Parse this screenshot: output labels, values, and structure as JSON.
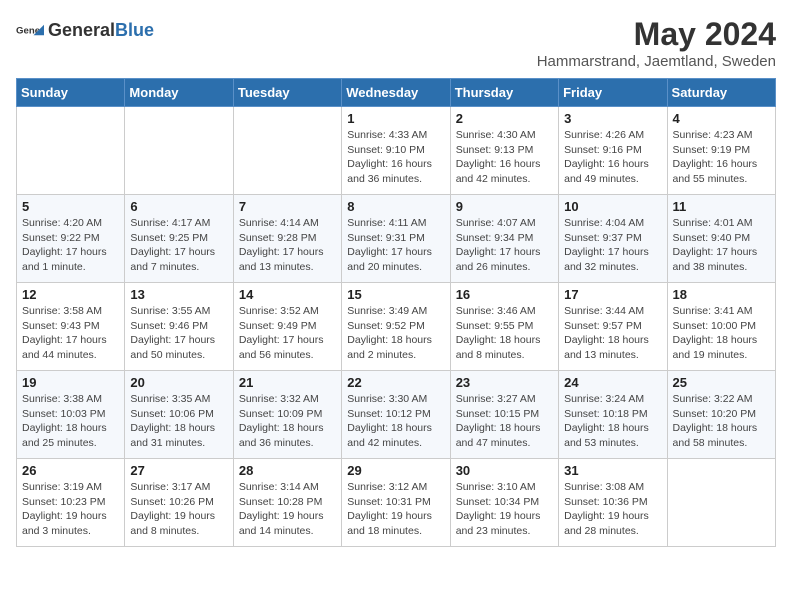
{
  "header": {
    "logo_general": "General",
    "logo_blue": "Blue",
    "month_title": "May 2024",
    "subtitle": "Hammarstrand, Jaemtland, Sweden"
  },
  "days_of_week": [
    "Sunday",
    "Monday",
    "Tuesday",
    "Wednesday",
    "Thursday",
    "Friday",
    "Saturday"
  ],
  "weeks": [
    [
      {
        "day": "",
        "info": ""
      },
      {
        "day": "",
        "info": ""
      },
      {
        "day": "",
        "info": ""
      },
      {
        "day": "1",
        "info": "Sunrise: 4:33 AM\nSunset: 9:10 PM\nDaylight: 16 hours and 36 minutes."
      },
      {
        "day": "2",
        "info": "Sunrise: 4:30 AM\nSunset: 9:13 PM\nDaylight: 16 hours and 42 minutes."
      },
      {
        "day": "3",
        "info": "Sunrise: 4:26 AM\nSunset: 9:16 PM\nDaylight: 16 hours and 49 minutes."
      },
      {
        "day": "4",
        "info": "Sunrise: 4:23 AM\nSunset: 9:19 PM\nDaylight: 16 hours and 55 minutes."
      }
    ],
    [
      {
        "day": "5",
        "info": "Sunrise: 4:20 AM\nSunset: 9:22 PM\nDaylight: 17 hours and 1 minute."
      },
      {
        "day": "6",
        "info": "Sunrise: 4:17 AM\nSunset: 9:25 PM\nDaylight: 17 hours and 7 minutes."
      },
      {
        "day": "7",
        "info": "Sunrise: 4:14 AM\nSunset: 9:28 PM\nDaylight: 17 hours and 13 minutes."
      },
      {
        "day": "8",
        "info": "Sunrise: 4:11 AM\nSunset: 9:31 PM\nDaylight: 17 hours and 20 minutes."
      },
      {
        "day": "9",
        "info": "Sunrise: 4:07 AM\nSunset: 9:34 PM\nDaylight: 17 hours and 26 minutes."
      },
      {
        "day": "10",
        "info": "Sunrise: 4:04 AM\nSunset: 9:37 PM\nDaylight: 17 hours and 32 minutes."
      },
      {
        "day": "11",
        "info": "Sunrise: 4:01 AM\nSunset: 9:40 PM\nDaylight: 17 hours and 38 minutes."
      }
    ],
    [
      {
        "day": "12",
        "info": "Sunrise: 3:58 AM\nSunset: 9:43 PM\nDaylight: 17 hours and 44 minutes."
      },
      {
        "day": "13",
        "info": "Sunrise: 3:55 AM\nSunset: 9:46 PM\nDaylight: 17 hours and 50 minutes."
      },
      {
        "day": "14",
        "info": "Sunrise: 3:52 AM\nSunset: 9:49 PM\nDaylight: 17 hours and 56 minutes."
      },
      {
        "day": "15",
        "info": "Sunrise: 3:49 AM\nSunset: 9:52 PM\nDaylight: 18 hours and 2 minutes."
      },
      {
        "day": "16",
        "info": "Sunrise: 3:46 AM\nSunset: 9:55 PM\nDaylight: 18 hours and 8 minutes."
      },
      {
        "day": "17",
        "info": "Sunrise: 3:44 AM\nSunset: 9:57 PM\nDaylight: 18 hours and 13 minutes."
      },
      {
        "day": "18",
        "info": "Sunrise: 3:41 AM\nSunset: 10:00 PM\nDaylight: 18 hours and 19 minutes."
      }
    ],
    [
      {
        "day": "19",
        "info": "Sunrise: 3:38 AM\nSunset: 10:03 PM\nDaylight: 18 hours and 25 minutes."
      },
      {
        "day": "20",
        "info": "Sunrise: 3:35 AM\nSunset: 10:06 PM\nDaylight: 18 hours and 31 minutes."
      },
      {
        "day": "21",
        "info": "Sunrise: 3:32 AM\nSunset: 10:09 PM\nDaylight: 18 hours and 36 minutes."
      },
      {
        "day": "22",
        "info": "Sunrise: 3:30 AM\nSunset: 10:12 PM\nDaylight: 18 hours and 42 minutes."
      },
      {
        "day": "23",
        "info": "Sunrise: 3:27 AM\nSunset: 10:15 PM\nDaylight: 18 hours and 47 minutes."
      },
      {
        "day": "24",
        "info": "Sunrise: 3:24 AM\nSunset: 10:18 PM\nDaylight: 18 hours and 53 minutes."
      },
      {
        "day": "25",
        "info": "Sunrise: 3:22 AM\nSunset: 10:20 PM\nDaylight: 18 hours and 58 minutes."
      }
    ],
    [
      {
        "day": "26",
        "info": "Sunrise: 3:19 AM\nSunset: 10:23 PM\nDaylight: 19 hours and 3 minutes."
      },
      {
        "day": "27",
        "info": "Sunrise: 3:17 AM\nSunset: 10:26 PM\nDaylight: 19 hours and 8 minutes."
      },
      {
        "day": "28",
        "info": "Sunrise: 3:14 AM\nSunset: 10:28 PM\nDaylight: 19 hours and 14 minutes."
      },
      {
        "day": "29",
        "info": "Sunrise: 3:12 AM\nSunset: 10:31 PM\nDaylight: 19 hours and 18 minutes."
      },
      {
        "day": "30",
        "info": "Sunrise: 3:10 AM\nSunset: 10:34 PM\nDaylight: 19 hours and 23 minutes."
      },
      {
        "day": "31",
        "info": "Sunrise: 3:08 AM\nSunset: 10:36 PM\nDaylight: 19 hours and 28 minutes."
      },
      {
        "day": "",
        "info": ""
      }
    ]
  ]
}
